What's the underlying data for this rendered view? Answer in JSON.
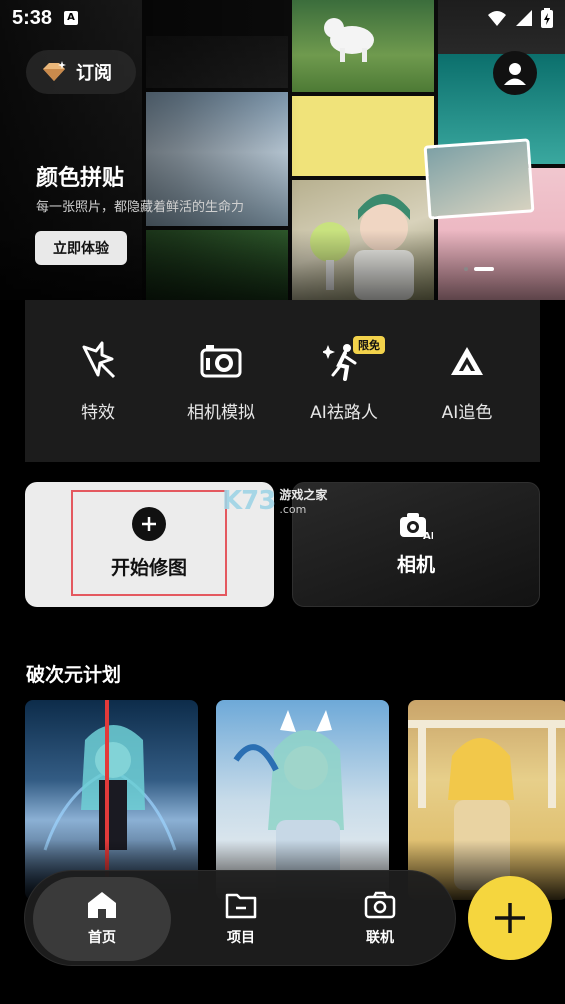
{
  "status_bar": {
    "time": "5:38"
  },
  "banner": {
    "subscribe_label": "订阅",
    "title": "颜色拼贴",
    "subtitle": "每一张照片，都隐藏着鲜活的生命力",
    "try_button": "立即体验"
  },
  "tools": [
    {
      "label": "特效",
      "icon": "magic-star-icon"
    },
    {
      "label": "相机模拟",
      "icon": "camera-simulate-icon"
    },
    {
      "label": "AI祛路人",
      "icon": "ai-remove-person-icon",
      "badge": "限免"
    },
    {
      "label": "AI追色",
      "icon": "ai-color-icon"
    }
  ],
  "actions": {
    "edit_label": "开始修图",
    "camera_label": "相机"
  },
  "watermark": {
    "brand": "K73",
    "name": "游戏之家",
    "domain": ".com"
  },
  "section": {
    "title": "破次元计划"
  },
  "nav": {
    "items": [
      {
        "label": "首页",
        "icon": "home-icon"
      },
      {
        "label": "项目",
        "icon": "folder-icon"
      },
      {
        "label": "联机",
        "icon": "camera-icon"
      }
    ]
  },
  "colors": {
    "accent": "#f5d63e",
    "highlight_border": "#e4585f"
  }
}
